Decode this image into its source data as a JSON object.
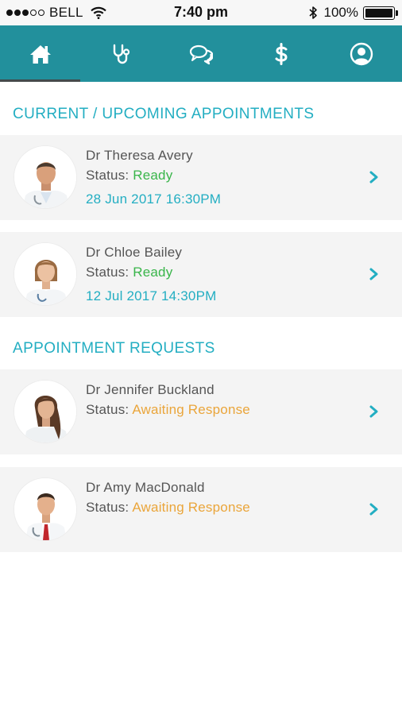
{
  "status_bar": {
    "carrier": "BELL",
    "time": "7:40 pm",
    "battery": "100%",
    "battery_level": 1.0,
    "signal_dots": [
      true,
      true,
      true,
      false,
      false
    ]
  },
  "nav": {
    "tabs": [
      {
        "icon": "home-icon",
        "active": true
      },
      {
        "icon": "stethoscope-icon",
        "active": false
      },
      {
        "icon": "chat-bubbles-icon",
        "active": false
      },
      {
        "icon": "dollar-icon",
        "active": false
      },
      {
        "icon": "user-profile-icon",
        "active": false
      }
    ]
  },
  "sections": {
    "current_title": "CURRENT / UPCOMING APPOINTMENTS",
    "requests_title": "APPOINTMENT REQUESTS"
  },
  "status_label": "Status:",
  "appointments": [
    {
      "name": "Dr Theresa Avery",
      "status": "Ready",
      "datetime": "28 Jun 2017 16:30PM"
    },
    {
      "name": "Dr Chloe Bailey",
      "status": "Ready",
      "datetime": "12 Jul 2017 14:30PM"
    }
  ],
  "requests": [
    {
      "name": "Dr Jennifer Buckland",
      "status": "Awaiting Response"
    },
    {
      "name": "Dr Amy MacDonald",
      "status": "Awaiting Response"
    }
  ],
  "colors": {
    "header": "#22909c",
    "accent": "#23aec2",
    "ready": "#39b54a",
    "awaiting": "#eaa53a",
    "card_bg": "#f4f4f4"
  }
}
